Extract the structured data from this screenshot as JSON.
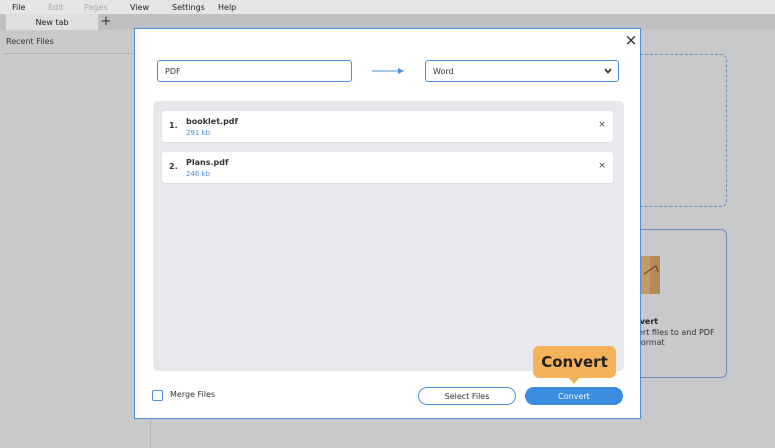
{
  "menu": {
    "file": "File",
    "edit": "Edit",
    "pages": "Pages",
    "view": "View",
    "settings": "Settings",
    "help": "Help"
  },
  "tabs": {
    "active": "New tab",
    "add": "+"
  },
  "sidebar": {
    "title": "Recent Files"
  },
  "background_card": {
    "title": "nvert",
    "description": "ert files to and PDF format"
  },
  "dialog": {
    "close": "×",
    "from_format": "PDF",
    "to_format": "Word",
    "files": [
      {
        "number": "1.",
        "name": "booklet.pdf",
        "size": "291 kb",
        "remove": "×"
      },
      {
        "number": "2.",
        "name": "Plans.pdf",
        "size": "246 kb",
        "remove": "×"
      }
    ],
    "merge_label": "Merge Files",
    "select_files_label": "Select Files",
    "convert_label": "Convert"
  },
  "tooltip": {
    "text": "Convert"
  },
  "colors": {
    "accent": "#3b8de0",
    "border": "#4a90d9",
    "tooltip": "#f6b25a"
  },
  "icons": {
    "arrow": "arrow-right-icon",
    "chevron": "chevron-down-icon",
    "close": "close-icon"
  }
}
